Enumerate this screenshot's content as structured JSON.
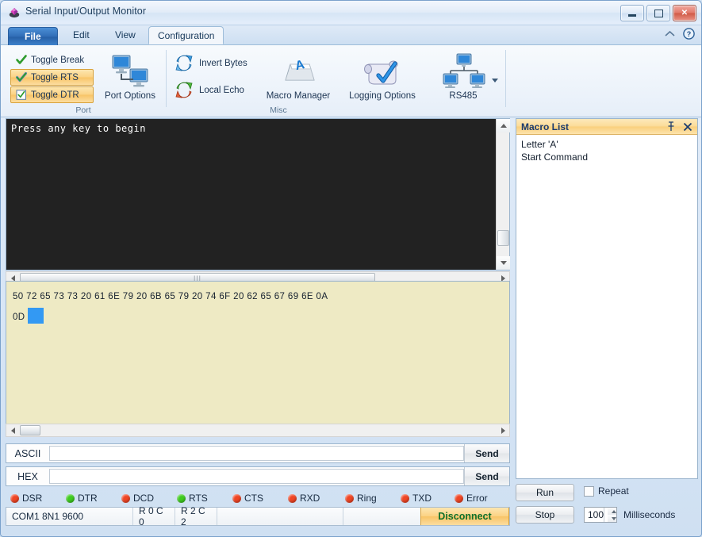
{
  "window": {
    "title": "Serial Input/Output Monitor",
    "app_icon": "app-diamond-icon",
    "minimize_label": "",
    "maximize_label": "",
    "close_label": "✕"
  },
  "tabs": [
    {
      "label": "File",
      "type": "file",
      "selected": false
    },
    {
      "label": "Edit",
      "type": "normal",
      "selected": false
    },
    {
      "label": "View",
      "type": "normal",
      "selected": false
    },
    {
      "label": "Configuration",
      "type": "normal",
      "selected": true
    }
  ],
  "ribbon": {
    "groups": [
      {
        "name": "Port",
        "label": "Port",
        "toggles": [
          {
            "label": "Toggle Break",
            "active": false,
            "icon": "green-check-icon"
          },
          {
            "label": "Toggle RTS",
            "active": true,
            "icon": "green-check-icon"
          },
          {
            "label": "Toggle DTR",
            "active": true,
            "icon": "checkbox-checked-icon"
          }
        ],
        "buttons": [
          {
            "label": "Port Options",
            "icon": "two-monitors-network-icon"
          }
        ]
      },
      {
        "name": "Misc",
        "label": "Misc",
        "small_buttons": [
          {
            "label": "Invert Bytes",
            "icon": "blue-recycle-arrows-icon"
          },
          {
            "label": "Local Echo",
            "icon": "green-red-recycle-arrows-icon"
          }
        ],
        "buttons": [
          {
            "label": "Macro Manager",
            "icon": "keyboard-key-a-icon"
          },
          {
            "label": "Logging Options",
            "icon": "scroll-checkmark-icon"
          },
          {
            "label": "RS485",
            "icon": "three-monitors-network-icon"
          }
        ],
        "dropdown": "chevron-down-icon"
      }
    ],
    "help_icons": [
      {
        "name": "collapse-ribbon-icon",
        "glyph": "⌃"
      },
      {
        "name": "help-icon",
        "glyph": "?"
      }
    ]
  },
  "terminal": {
    "text": "Press any key to begin",
    "background": "#222222",
    "foreground": "#ffffff"
  },
  "hex_pane": {
    "background": "#eeeac4",
    "lines": [
      "50 72 65 73 73 20 61 6E 79 20 6B 65 79 20 74 6F 20 62 65 67 69 6E 0A",
      "0D"
    ],
    "cursor_color": "#3399f3"
  },
  "send_rows": [
    {
      "label": "ASCII",
      "value": "",
      "button": "Send"
    },
    {
      "label": "HEX",
      "value": "",
      "button": "Send"
    }
  ],
  "leds": [
    {
      "label": "DSR",
      "color": "#f04524",
      "state": "off"
    },
    {
      "label": "DTR",
      "color": "#3ecc1f",
      "state": "on"
    },
    {
      "label": "DCD",
      "color": "#f04524",
      "state": "off"
    },
    {
      "label": "RTS",
      "color": "#3ecc1f",
      "state": "on"
    },
    {
      "label": "CTS",
      "color": "#f04524",
      "state": "off"
    },
    {
      "label": "RXD",
      "color": "#f04524",
      "state": "off"
    },
    {
      "label": "Ring",
      "color": "#f04524",
      "state": "off"
    },
    {
      "label": "TXD",
      "color": "#f04524",
      "state": "off"
    },
    {
      "label": "Error",
      "color": "#f04524",
      "state": "off"
    }
  ],
  "status_bar": {
    "cells": [
      "COM1 8N1 9600",
      "R 0 C 0",
      "R 2 C 2",
      ""
    ],
    "connection_button": "Disconnect",
    "connection_color": "#11702a"
  },
  "macro_panel": {
    "title": "Macro List",
    "pin_icon": "pin-icon",
    "close_icon": "close-icon",
    "items": [
      "Letter 'A'",
      "Start Command"
    ],
    "controls": {
      "run": "Run",
      "stop": "Stop",
      "repeat_label": "Repeat",
      "repeat_checked": false,
      "interval_value": "100",
      "interval_unit": "Milliseconds"
    }
  }
}
